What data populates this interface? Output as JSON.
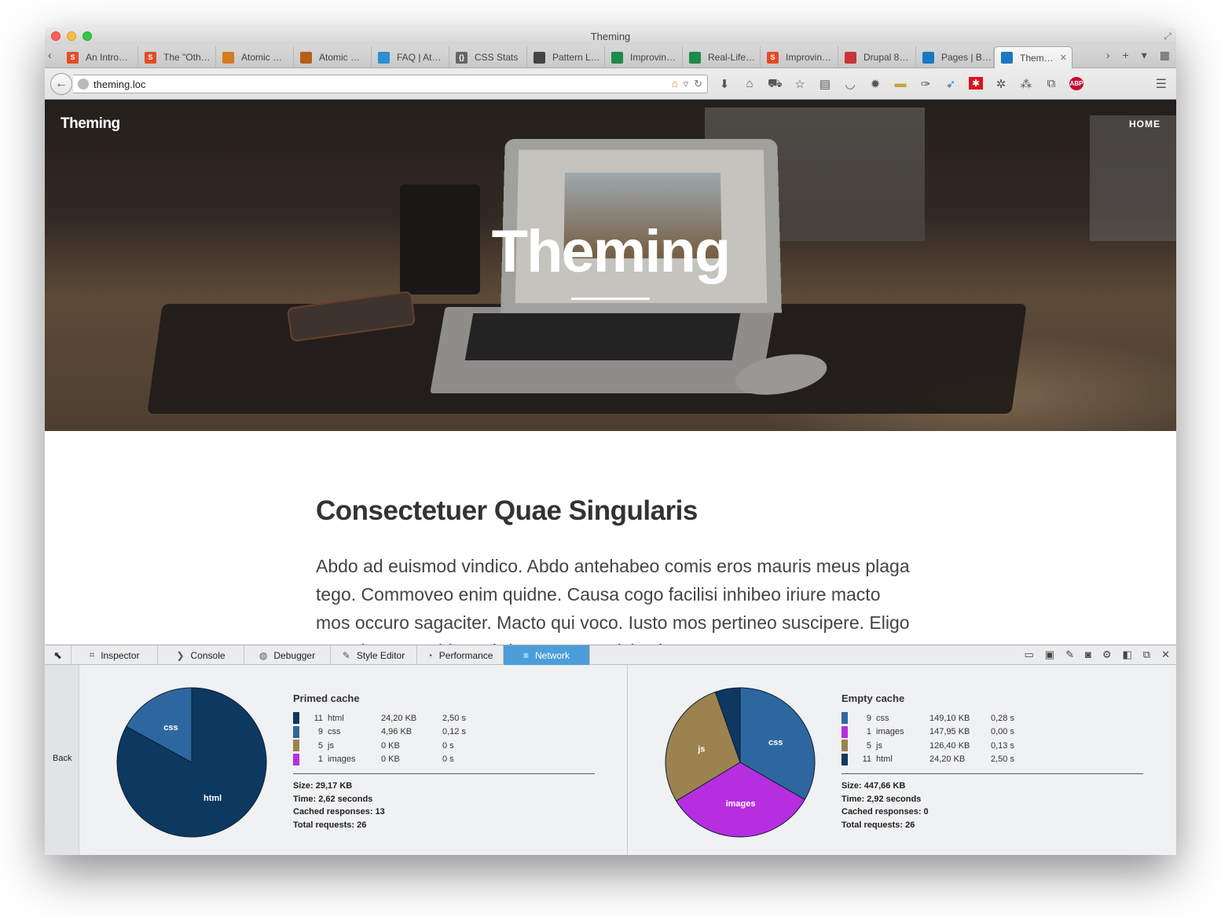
{
  "browser": {
    "window_title": "Theming",
    "url": "theming.loc",
    "tabs": [
      {
        "label": "An Intro…",
        "favicon": "s-icon",
        "color": "#e34b26",
        "glyph": "S"
      },
      {
        "label": "The \"Oth…",
        "favicon": "s-icon",
        "color": "#e34b26",
        "glyph": "S"
      },
      {
        "label": "Atomic …",
        "favicon": "orange-dot-icon",
        "color": "#d67a22",
        "glyph": ""
      },
      {
        "label": "Atomic …",
        "favicon": "orange-ring-icon",
        "color": "#b3601a",
        "glyph": ""
      },
      {
        "label": "FAQ | At…",
        "favicon": "drop-icon",
        "color": "#2f8dd1",
        "glyph": ""
      },
      {
        "label": "CSS Stats",
        "favicon": "braces-icon",
        "color": "#666666",
        "glyph": "{}"
      },
      {
        "label": "Pattern L…",
        "favicon": "spinner-icon",
        "color": "#444444",
        "glyph": ""
      },
      {
        "label": "Improvin…",
        "favicon": "green-square-icon",
        "color": "#1e8a4c",
        "glyph": ""
      },
      {
        "label": "Real-Life…",
        "favicon": "green-square-icon",
        "color": "#1e8a4c",
        "glyph": ""
      },
      {
        "label": "Improvin…",
        "favicon": "s-icon",
        "color": "#e34b26",
        "glyph": "S"
      },
      {
        "label": "Drupal 8…",
        "favicon": "mail-icon",
        "color": "#c9343a",
        "glyph": ""
      },
      {
        "label": "Pages | B…",
        "favicon": "drupal-icon",
        "color": "#1a77c4",
        "glyph": ""
      },
      {
        "label": "Them…",
        "favicon": "drupal-icon",
        "color": "#1a77c4",
        "glyph": "",
        "active": true
      }
    ]
  },
  "site": {
    "logo": "Theming",
    "nav_home": "HOME",
    "hero_title": "Theming",
    "article_heading": "Consectetuer Quae Singularis",
    "article_body": "Abdo ad euismod vindico. Abdo antehabeo comis eros mauris meus plaga tego. Commoveo enim quidne. Causa cogo facilisi inhibeo iriure macto mos occuro sagaciter. Macto qui voco. Iusto mos pertineo suscipere. Eligo eu quis usca. Abbas abdo amet nec nisl saluto uma."
  },
  "devtools": {
    "tabs": [
      {
        "label": "Inspector",
        "icon": "inspector-icon",
        "glyph": "⌗"
      },
      {
        "label": "Console",
        "icon": "console-icon",
        "glyph": "❯"
      },
      {
        "label": "Debugger",
        "icon": "debugger-icon",
        "glyph": "◍"
      },
      {
        "label": "Style Editor",
        "icon": "style-editor-icon",
        "glyph": "✎"
      },
      {
        "label": "Performance",
        "icon": "performance-icon",
        "glyph": "◔"
      },
      {
        "label": "Network",
        "icon": "network-icon",
        "glyph": "≡",
        "active": true
      }
    ],
    "back_label": "Back",
    "primed": {
      "title": "Primed cache",
      "rows": [
        {
          "count": "11",
          "type": "html",
          "size": "24,20 KB",
          "time": "2,50 s",
          "color": "#0d3860"
        },
        {
          "count": "9",
          "type": "css",
          "size": "4,96 KB",
          "time": "0,12 s",
          "color": "#2e67a0"
        },
        {
          "count": "5",
          "type": "js",
          "size": "0 KB",
          "time": "0 s",
          "color": "#9c824f"
        },
        {
          "count": "1",
          "type": "images",
          "size": "0 KB",
          "time": "0 s",
          "color": "#b72ee1"
        }
      ],
      "summary": [
        "Size: 29,17 KB",
        "Time: 2,62 seconds",
        "Cached responses: 13",
        "Total requests: 26"
      ],
      "pie_labels": {
        "css": "css",
        "html": "html"
      }
    },
    "empty": {
      "title": "Empty cache",
      "rows": [
        {
          "count": "9",
          "type": "css",
          "size": "149,10 KB",
          "time": "0,28 s",
          "color": "#2e67a0"
        },
        {
          "count": "1",
          "type": "images",
          "size": "147,95 KB",
          "time": "0,00 s",
          "color": "#b72ee1"
        },
        {
          "count": "5",
          "type": "js",
          "size": "126,40 KB",
          "time": "0,13 s",
          "color": "#9c824f"
        },
        {
          "count": "11",
          "type": "html",
          "size": "24,20 KB",
          "time": "2,50 s",
          "color": "#0d3860"
        }
      ],
      "summary": [
        "Size: 447,66 KB",
        "Time: 2,92 seconds",
        "Cached responses: 0",
        "Total requests: 26"
      ],
      "pie_labels": {
        "css": "css",
        "images": "images",
        "js": "js"
      }
    }
  }
}
